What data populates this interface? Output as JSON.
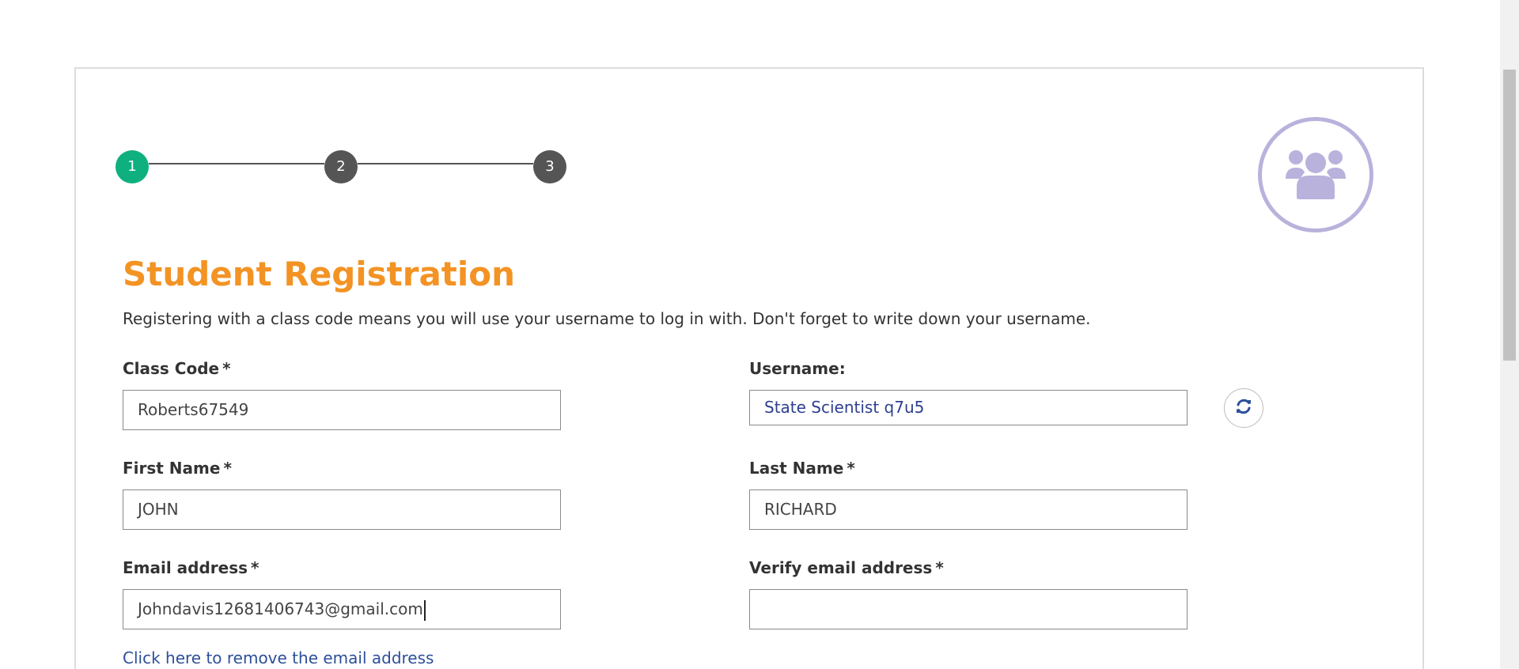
{
  "stepper": {
    "steps": [
      "1",
      "2",
      "3"
    ],
    "active_step": 1,
    "active_color": "#0fb07f",
    "inactive_color": "#555555"
  },
  "badge": {
    "icon": "users-group-icon",
    "color": "#b9b2dc"
  },
  "title": "Student Registration",
  "intro": "Registering with a class code means you will use your username to log in with. Don't forget to write down your username.",
  "form": {
    "class_code": {
      "label": "Class Code",
      "required": "*",
      "value": "Roberts67549"
    },
    "username": {
      "label": "Username:",
      "value": "State Scientist q7u5",
      "refresh_icon": "refresh-icon"
    },
    "first_name": {
      "label": "First Name",
      "required": "*",
      "value": "JOHN"
    },
    "last_name": {
      "label": "Last Name",
      "required": "*",
      "value": "RICHARD"
    },
    "email": {
      "label": "Email address",
      "required": "*",
      "value": "Johndavis12681406743@gmail.com"
    },
    "verify_email": {
      "label": "Verify email address",
      "required": "*",
      "value": ""
    },
    "remove_email_link": "Click here to remove the email address"
  },
  "colors": {
    "title": "#f39324",
    "link": "#2d4f9a",
    "username_text": "#2d3f8f"
  }
}
